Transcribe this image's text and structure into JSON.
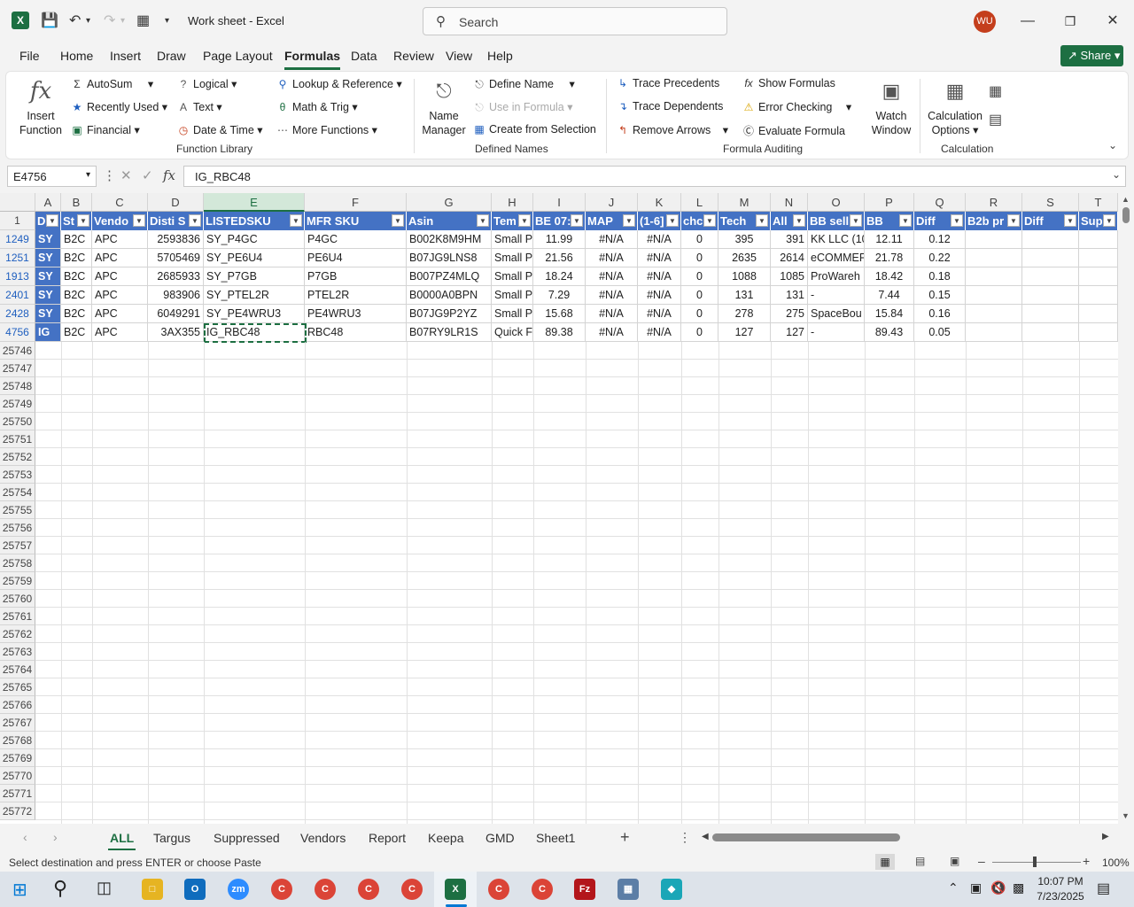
{
  "titlebar": {
    "doc_title": "Work sheet  -  Excel",
    "search_placeholder": "Search",
    "avatar": "WU",
    "share": "Share"
  },
  "menu": [
    "File",
    "Home",
    "Insert",
    "Draw",
    "Page Layout",
    "Formulas",
    "Data",
    "Review",
    "View",
    "Help"
  ],
  "ribbon": {
    "insert_function": [
      "Insert",
      "Function"
    ],
    "autosum": "AutoSum",
    "recently_used": "Recently Used",
    "financial": "Financial",
    "logical": "Logical",
    "text": "Text",
    "date_time": "Date & Time",
    "lookup": "Lookup & Reference",
    "math": "Math & Trig",
    "more_functions": "More Functions",
    "function_library": "Function Library",
    "name_manager": [
      "Name",
      "Manager"
    ],
    "define_name": "Define Name",
    "use_in_formula": "Use in Formula",
    "create_from_selection": "Create from Selection",
    "defined_names": "Defined Names",
    "trace_precedents": "Trace Precedents",
    "trace_dependents": "Trace Dependents",
    "remove_arrows": "Remove Arrows",
    "show_formulas": "Show Formulas",
    "error_checking": "Error Checking",
    "evaluate_formula": "Evaluate Formula",
    "watch_window": [
      "Watch",
      "Window"
    ],
    "formula_auditing": "Formula Auditing",
    "calc_options": [
      "Calculation",
      "Options"
    ],
    "calculation": "Calculation"
  },
  "formula_bar": {
    "name_box": "E4756",
    "formula": "IG_RBC48"
  },
  "columns": [
    "A",
    "B",
    "C",
    "D",
    "E",
    "F",
    "G",
    "H",
    "I",
    "J",
    "K",
    "L",
    "M",
    "N",
    "O",
    "P",
    "Q",
    "R",
    "S",
    "T"
  ],
  "headers": [
    "D",
    "St",
    "Vendo",
    "Disti S",
    "LISTEDSKU",
    "MFR SKU",
    "Asin",
    "Tem",
    "BE 07:",
    "MAP",
    "(1-6]",
    "chc",
    "Tech",
    "All",
    "BB sell",
    "BB",
    "Diff",
    "B2b pr",
    "Diff",
    "Sup"
  ],
  "rows": [
    {
      "num": "1249",
      "cells": [
        "SY",
        "B2C",
        "APC",
        "2593836",
        "SY_P4GC",
        "P4GC",
        "B002K8M9HM",
        "Small P",
        "11.99",
        "#N/A",
        "#N/A",
        "0",
        "395",
        "391",
        "KK LLC (10",
        "12.11",
        "0.12",
        "",
        "",
        ""
      ]
    },
    {
      "num": "1251",
      "cells": [
        "SY",
        "B2C",
        "APC",
        "5705469",
        "SY_PE6U4",
        "PE6U4",
        "B07JG9LNS8",
        "Small P",
        "21.56",
        "#N/A",
        "#N/A",
        "0",
        "2635",
        "2614",
        "eCOMMEF",
        "21.78",
        "0.22",
        "",
        "",
        ""
      ]
    },
    {
      "num": "1913",
      "cells": [
        "SY",
        "B2C",
        "APC",
        "2685933",
        "SY_P7GB",
        "P7GB",
        "B007PZ4MLQ",
        "Small P",
        "18.24",
        "#N/A",
        "#N/A",
        "0",
        "1088",
        "1085",
        "ProWareh",
        "18.42",
        "0.18",
        "",
        "",
        ""
      ]
    },
    {
      "num": "2401",
      "cells": [
        "SY",
        "B2C",
        "APC",
        "983906",
        "SY_PTEL2R",
        "PTEL2R",
        "B0000A0BPN",
        "Small P",
        "7.29",
        "#N/A",
        "#N/A",
        "0",
        "131",
        "131",
        "-",
        "7.44",
        "0.15",
        "",
        "",
        ""
      ]
    },
    {
      "num": "2428",
      "cells": [
        "SY",
        "B2C",
        "APC",
        "6049291",
        "SY_PE4WRU3",
        "PE4WRU3",
        "B07JG9P2YZ",
        "Small P",
        "15.68",
        "#N/A",
        "#N/A",
        "0",
        "278",
        "275",
        "SpaceBou",
        "15.84",
        "0.16",
        "",
        "",
        ""
      ]
    },
    {
      "num": "4756",
      "cells": [
        "IG",
        "B2C",
        "APC",
        "3AX355",
        "IG_RBC48",
        "RBC48",
        "B07RY9LR1S",
        "Quick F",
        "89.38",
        "#N/A",
        "#N/A",
        "0",
        "127",
        "127",
        "-",
        "89.43",
        "0.05",
        "",
        "",
        ""
      ]
    }
  ],
  "empty_rows": [
    "25746",
    "25747",
    "25748",
    "25749",
    "25750",
    "25751",
    "25752",
    "25753",
    "25754",
    "25755",
    "25756",
    "25757",
    "25758",
    "25759",
    "25760",
    "25761",
    "25762",
    "25763",
    "25764",
    "25765",
    "25766",
    "25767",
    "25768",
    "25769",
    "25770",
    "25771",
    "25772"
  ],
  "sheet_tabs": [
    "ALL",
    "Targus",
    "Suppressed",
    "Vendors",
    "Report",
    "Keepa",
    "GMD",
    "Sheet1"
  ],
  "status": {
    "message": "Select destination and press ENTER or choose Paste",
    "zoom": "100%"
  },
  "taskbar": {
    "time": "10:07 PM",
    "date": "7/23/2025"
  },
  "colors": {
    "accent": "#1d6f42",
    "header_blue": "#4472c4"
  }
}
